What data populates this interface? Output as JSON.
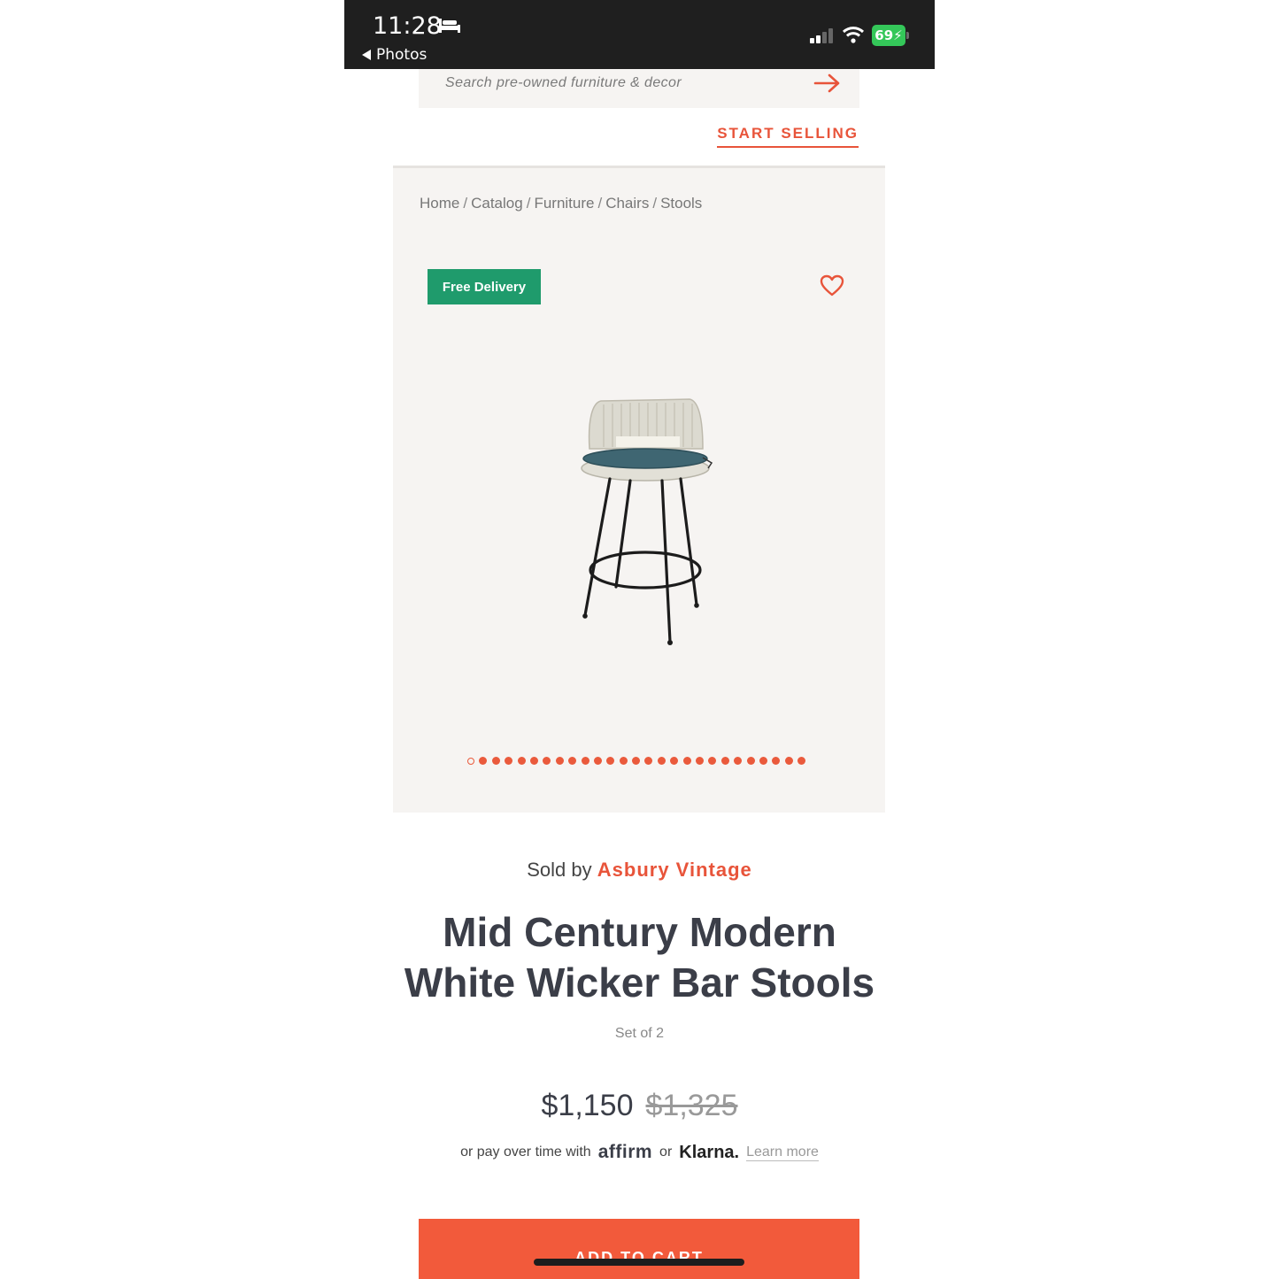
{
  "status_bar": {
    "time": "11:28",
    "back_label": "Photos",
    "battery": "69"
  },
  "search": {
    "placeholder": "Search pre-owned furniture & decor"
  },
  "header": {
    "start_selling": "START SELLING"
  },
  "breadcrumb": [
    "Home",
    "Catalog",
    "Furniture",
    "Chairs",
    "Stools"
  ],
  "gallery": {
    "badge": "Free Delivery",
    "image_count": 27,
    "active_index": 0
  },
  "product": {
    "sold_by_prefix": "Sold by",
    "seller": "Asbury Vintage",
    "title_line1": "Mid Century Modern",
    "title_line2": "White Wicker Bar Stools",
    "subtitle": "Set of 2",
    "price": "$1,150",
    "original_price": "$1,325"
  },
  "financing": {
    "prefix": "or pay over time with",
    "affirm": "affirm",
    "or": "or",
    "klarna": "Klarna.",
    "learn_more": "Learn more"
  },
  "cart": {
    "label": "ADD TO CART"
  },
  "colors": {
    "accent": "#e8543a",
    "badge": "#1f9b6c",
    "button": "#f25a3b"
  }
}
